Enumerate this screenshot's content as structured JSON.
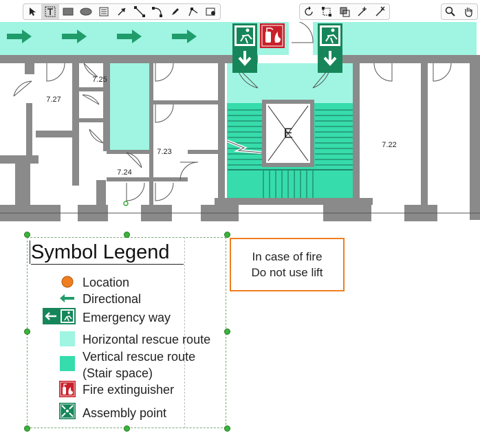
{
  "toolbar": {
    "tools": [
      {
        "name": "select-tool",
        "icon": "arrow-pointer-icon",
        "selected": false
      },
      {
        "name": "text-tool",
        "icon": "text-box-icon",
        "selected": true
      },
      {
        "name": "rectangle-tool",
        "icon": "rectangle-icon",
        "selected": false
      },
      {
        "name": "ellipse-tool",
        "icon": "ellipse-icon",
        "selected": false
      },
      {
        "name": "note-tool",
        "icon": "note-icon",
        "selected": false
      },
      {
        "name": "arrow-tool",
        "icon": "arrow-icon",
        "selected": false
      },
      {
        "name": "line-tool",
        "icon": "line-icon",
        "selected": false
      },
      {
        "name": "arc-tool",
        "icon": "arc-icon",
        "selected": false
      },
      {
        "name": "pen-tool",
        "icon": "pen-icon",
        "selected": false
      },
      {
        "name": "polyline-tool",
        "icon": "polyline-icon",
        "selected": false
      },
      {
        "name": "image-insert-tool",
        "icon": "image-insert-icon",
        "selected": false
      },
      {
        "name": "rotate-tool",
        "icon": "rotate-icon",
        "selected": false
      },
      {
        "name": "crop-tool",
        "icon": "crop-icon",
        "selected": false
      },
      {
        "name": "resize-tool",
        "icon": "resize-icon",
        "selected": false
      },
      {
        "name": "add-point-tool",
        "icon": "add-point-icon",
        "selected": false
      },
      {
        "name": "delete-point-tool",
        "icon": "delete-point-icon",
        "selected": false
      },
      {
        "name": "zoom-tool",
        "icon": "magnifier-icon",
        "selected": false
      },
      {
        "name": "pan-tool",
        "icon": "hand-icon",
        "selected": false
      }
    ]
  },
  "floorplan": {
    "rooms": [
      "7.27",
      "7.25",
      "7.23",
      "7.24",
      "7.22"
    ],
    "elevator_letter": "E",
    "colors": {
      "horizontal_route": "#9ff5e1",
      "vertical_route": "#36dcab",
      "wall": "#8a8a8a",
      "sign_green": "#16865a",
      "sign_red": "#c8202a"
    }
  },
  "legend": {
    "title": "Symbol Legend",
    "items": [
      {
        "symbol": "location-dot-icon",
        "label": "Location"
      },
      {
        "symbol": "directional-arrow-icon",
        "label": "Directional"
      },
      {
        "symbol": "emergency-exit-sign-icon",
        "label": "Emergency way"
      },
      {
        "symbol": "horizontal-route-swatch",
        "label": "Horizontal rescue route"
      },
      {
        "symbol": "vertical-route-swatch",
        "label": "Vertical rescue route"
      },
      {
        "symbol": "",
        "label": "(Stair space)"
      },
      {
        "symbol": "fire-extinguisher-sign-icon",
        "label": "Fire extinguisher"
      },
      {
        "symbol": "assembly-point-sign-icon",
        "label": "Assembly point"
      }
    ]
  },
  "note": {
    "line1": "In case of fire",
    "line2": "Do not use lift"
  }
}
